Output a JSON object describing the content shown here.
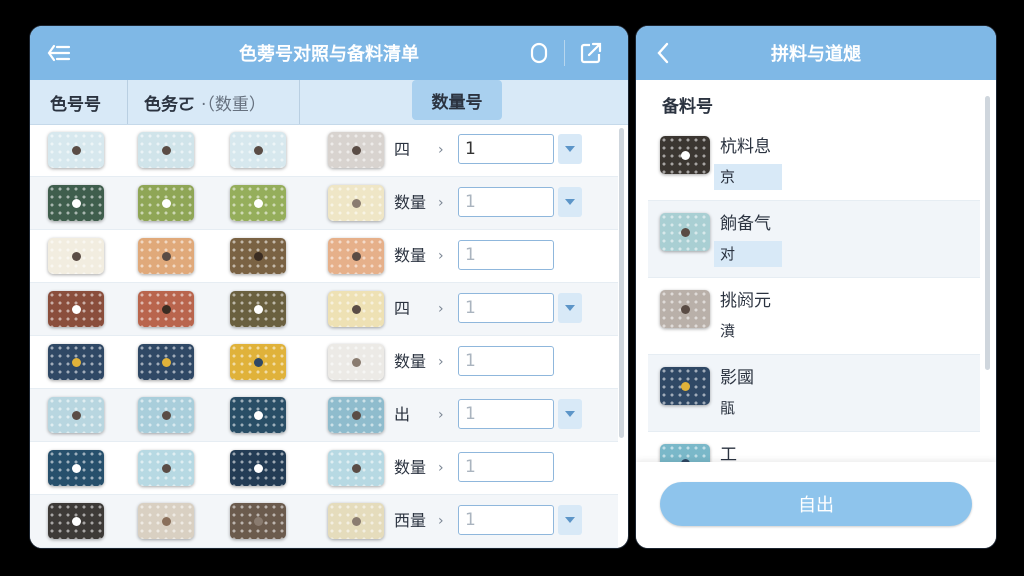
{
  "left": {
    "title": "色蒡号对照与备料清单",
    "icons": {
      "back": "back-list-icon",
      "bell": "bell-icon",
      "share": "share-icon"
    },
    "headers": {
      "col1": "色号号",
      "col2": "色务ㄛ",
      "col2_extra": "·（数重）",
      "col3": "数量号"
    },
    "rows": [
      {
        "colors": [
          "#d7e8ee",
          "#d0e4ea",
          "#d7e8ee",
          "#d8d3cf"
        ],
        "dots": [
          "#5a4c45",
          "#5a4c45",
          "#5a4c45",
          "#5a4c45"
        ],
        "label": "四",
        "qty": "1",
        "dropdown": true
      },
      {
        "colors": [
          "#3f5e4d",
          "#8fa656",
          "#95ae5b",
          "#efe6c6"
        ],
        "dots": [
          "#ffffff",
          "#ffffff",
          "#ffffff",
          "#8a7c70"
        ],
        "label": "数量",
        "qty": "1",
        "dropdown": true
      },
      {
        "colors": [
          "#f2ede0",
          "#e0a97a",
          "#7a6243",
          "#e6b08a"
        ],
        "dots": [
          "#5a4c45",
          "#5a4c45",
          "#3a2c22",
          "#5a4c45"
        ],
        "label": "数量",
        "qty": "1",
        "dropdown": false
      },
      {
        "colors": [
          "#8a4e3c",
          "#b9654d",
          "#6a603f",
          "#eee1b4"
        ],
        "dots": [
          "#ffffff",
          "#3a2c22",
          "#ffffff",
          "#5a4c45"
        ],
        "label": "四",
        "qty": "1",
        "dropdown": true
      },
      {
        "colors": [
          "#2f4865",
          "#2f4865",
          "#e0b23a",
          "#eceae6"
        ],
        "dots": [
          "#e0b23a",
          "#e0b23a",
          "#2f4865",
          "#8a7c70"
        ],
        "label": "数量",
        "qty": "1",
        "dropdown": false
      },
      {
        "colors": [
          "#b8d6e0",
          "#a9cedb",
          "#294e66",
          "#8fbccd"
        ],
        "dots": [
          "#5a4c45",
          "#5a4c45",
          "#ffffff",
          "#5a4c45"
        ],
        "label": "出",
        "qty": "1",
        "dropdown": true
      },
      {
        "colors": [
          "#27506c",
          "#b7d9e3",
          "#233c55",
          "#b7d9e3"
        ],
        "dots": [
          "#ffffff",
          "#5a4c45",
          "#ffffff",
          "#5a4c45"
        ],
        "label": "数量",
        "qty": "1",
        "dropdown": false
      },
      {
        "colors": [
          "#3d3a37",
          "#d9d0c2",
          "#6b5b4d",
          "#e5dcbc"
        ],
        "dots": [
          "#ffffff",
          "#8a6f5a",
          "#8a7c70",
          "#8a7c70"
        ],
        "label": "西量",
        "qty": "1",
        "dropdown": true
      }
    ]
  },
  "right": {
    "title": "拼料与道煺",
    "section_title": "备料号",
    "items": [
      {
        "color": "#3b3631",
        "dot": "#ffffff",
        "name": "杭料息",
        "tag": "京",
        "tag_style": "blue"
      },
      {
        "color": "#a9cfd3",
        "dot": "#5a4c45",
        "name": "餉备气",
        "tag": "对",
        "tag_style": "blue"
      },
      {
        "color": "#b9b0a9",
        "dot": "#5a4c45",
        "name": "挑阏元",
        "tag": "濆",
        "tag_style": "plain"
      },
      {
        "color": "#2f4865",
        "dot": "#e0b23a",
        "name": "影國",
        "tag": "瓹",
        "tag_style": "plain"
      },
      {
        "color": "#7ab8c9",
        "dot": "#2f4865",
        "name": "工",
        "tag": "",
        "tag_style": "plain"
      }
    ],
    "export_label": "自出"
  }
}
